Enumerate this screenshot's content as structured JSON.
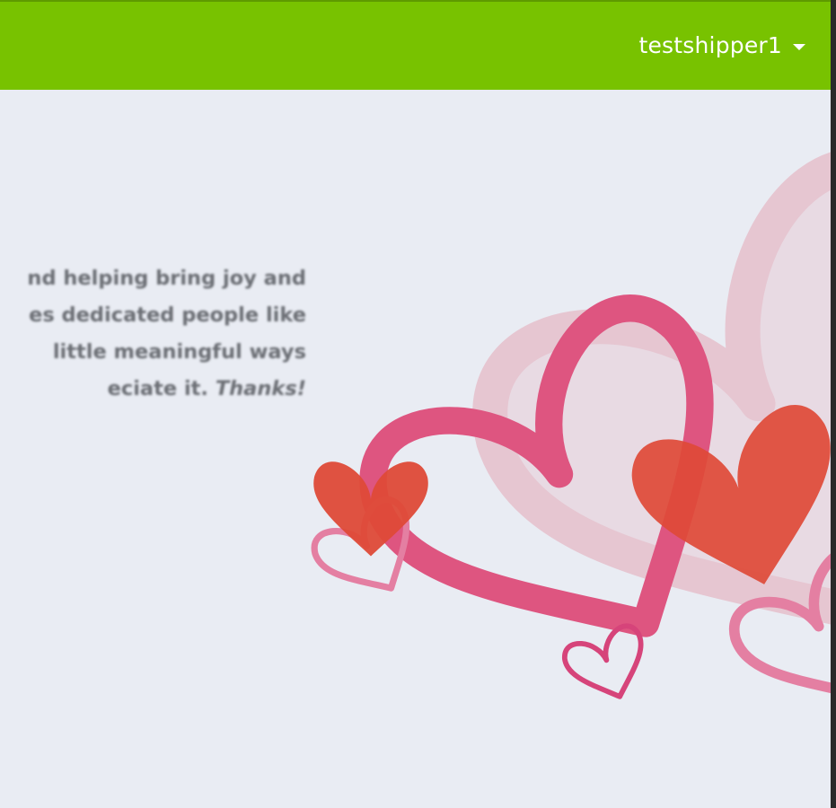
{
  "header": {
    "username": "testshipper1",
    "accent_color": "#78c200"
  },
  "message": {
    "line1": "nd helping bring joy and",
    "line2": "es dedicated people like",
    "line3": "little meaningful ways",
    "line4_prefix": "eciate it. ",
    "line4_emphasis": "Thanks!"
  },
  "decorations": {
    "colors": {
      "pale_heart": "#e6c6d1",
      "pink_heart": "#de5580",
      "red_heart": "#de4a37",
      "light_pink_outline": "#e47fa2",
      "magenta_outline": "#d6447a"
    }
  }
}
